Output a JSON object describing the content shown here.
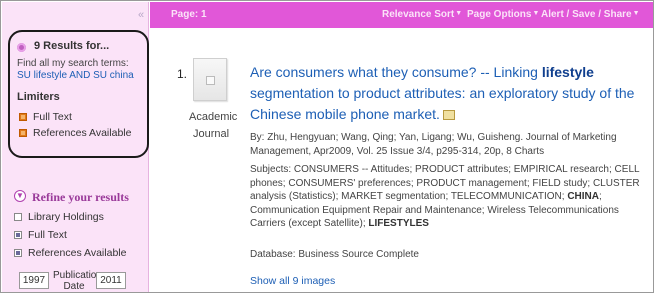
{
  "sidebar": {
    "collapse_glyph": "«",
    "results_heading": "9 Results for...",
    "find_all_label": "Find all my search terms:",
    "search_terms": "SU lifestyle AND SU china",
    "limiters_heading": "Limiters",
    "limiters": [
      "Full Text",
      "References Available"
    ],
    "refine_label": "Refine your results",
    "refine_options": [
      {
        "label": "Library Holdings",
        "checked": false
      },
      {
        "label": "Full Text",
        "checked": true
      },
      {
        "label": "References Available",
        "checked": true
      }
    ],
    "date_from": "1997",
    "date_to": "2011",
    "publication_date_label": "Publication Date"
  },
  "topbar": {
    "page_label": "Page: 1",
    "sort": "Relevance Sort",
    "page_options": "Page Options",
    "alert_save_share": "Alert / Save / Share"
  },
  "result": {
    "number": "1.",
    "doc_type_line1": "Academic",
    "doc_type_line2": "Journal",
    "title_part1": "Are consumers what they consume? -- Linking ",
    "title_bold": "lifestyle",
    "title_part2": " segmentation to product attributes: an exploratory study of the Chinese mobile phone market.",
    "byline": "By: Zhu, Hengyuan; Wang, Qing; Yan, Ligang; Wu, Guisheng. Journal of Marketing Management, Apr2009, Vol. 25 Issue 3/4, p295-314, 20p, 8 Charts",
    "subjects_text": "Subjects: CONSUMERS -- Attitudes; PRODUCT attributes; EMPIRICAL research; CELL phones; CONSUMERS' preferences; PRODUCT management; FIELD study; CLUSTER analysis (Statistics); MARKET segmentation; TELECOMMUNICATION; ",
    "subjects_bold1": "CHINA",
    "subjects_text2": "; Communication Equipment Repair and Maintenance; Wireless Telecommunications Carriers (except Satellite); ",
    "subjects_bold2": "LIFESTYLES",
    "database": "Database: Business Source Complete",
    "show_images": "Show all 9 images"
  },
  "colors": {
    "topbar": "#e157d8",
    "sidebar": "#fbe3f8",
    "link": "#1d5fb5",
    "refine": "#9a3a9a"
  }
}
